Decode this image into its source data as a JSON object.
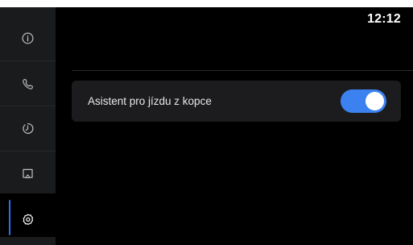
{
  "status_bar": {
    "time": "12:12"
  },
  "sidebar": {
    "items": [
      {
        "icon": "info-icon",
        "active": false
      },
      {
        "icon": "phone-icon",
        "active": false
      },
      {
        "icon": "history-icon",
        "active": false
      },
      {
        "icon": "screen-mirroring-icon",
        "active": false
      },
      {
        "icon": "gear-icon",
        "active": true
      }
    ]
  },
  "settings": {
    "items": [
      {
        "label": "Asistent pro jízdu z kopce",
        "enabled": true
      }
    ]
  },
  "colors": {
    "accent": "#3b82f0",
    "sidebar_bg": "#1a1b1d",
    "card_bg": "#1c1c1f",
    "active_indicator": "#2f6ff2"
  }
}
